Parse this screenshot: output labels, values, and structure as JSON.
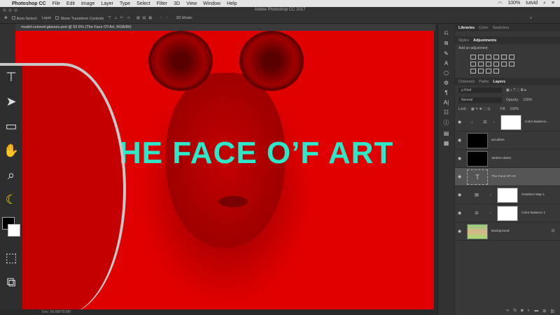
{
  "menubar": {
    "apple": "",
    "app": "Photoshop CC",
    "items": [
      "File",
      "Edit",
      "Image",
      "Layer",
      "Type",
      "Select",
      "Filter",
      "3D",
      "View",
      "Window",
      "Help"
    ],
    "battery": "100%",
    "user": "tutvid"
  },
  "window_title": "Adobe Photoshop CC 2017",
  "options": {
    "auto_select": "Auto-Select:",
    "auto_select_value": "Layer",
    "show_transform": "Show Transform Controls",
    "mode_3d": "3D Mode:"
  },
  "document_tab": "model-colored-glasses.psd @ 52.6% (The Face O'f Art, RGB/8#)",
  "canvas": {
    "headline": "HE FACE O’F ART"
  },
  "status": {
    "doc": "Doc: 56.6M/79.8M"
  },
  "panels": {
    "top_tabs": [
      "Libraries",
      "Color",
      "Swatches"
    ],
    "adj_tabs": [
      "Styles",
      "Adjustments"
    ],
    "add_adjustment": "Add an adjustment",
    "layer_tabs": [
      "Channels",
      "Paths",
      "Layers"
    ],
    "filter_kind": "ρ Kind",
    "blend_mode": "Normal",
    "opacity_label": "Opacity:",
    "opacity": "100%",
    "lock_label": "Lock:",
    "fill_label": "Fill:",
    "fill": "100%"
  },
  "layers": [
    {
      "name": "Color Balance...",
      "type": "adjustment"
    },
    {
      "name": "acculites",
      "type": "pixel"
    },
    {
      "name": "darken-darks",
      "type": "pixel"
    },
    {
      "name": "The Face O'f Art",
      "type": "text",
      "active": true
    },
    {
      "name": "Gradient Map 1",
      "type": "adjustment"
    },
    {
      "name": "Color Balance 1",
      "type": "adjustment"
    },
    {
      "name": "Background",
      "type": "image",
      "locked": true
    }
  ],
  "colors": {
    "accent_text": "#2ee6c8",
    "canvas_red": "#e00000"
  }
}
